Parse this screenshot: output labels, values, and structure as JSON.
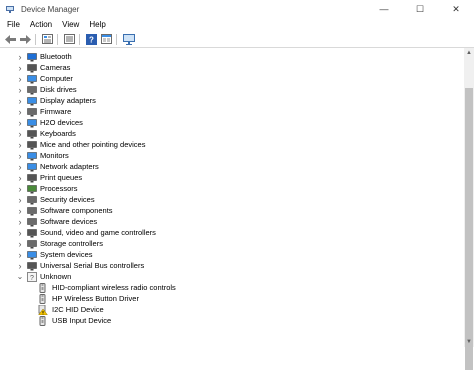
{
  "window": {
    "title": "Device Manager"
  },
  "controls": {
    "minimize": "—",
    "maximize": "☐",
    "close": "✕"
  },
  "menu": [
    "File",
    "Action",
    "View",
    "Help"
  ],
  "toolbar": [
    "back-icon",
    "forward-icon",
    "properties-icon",
    "show-hide-icon",
    "help-icon",
    "view-icon",
    "scan-hardware-icon"
  ],
  "tree": {
    "categories": [
      {
        "label": "Bluetooth",
        "icon": "bluetooth-icon",
        "color": "#1e6fd6"
      },
      {
        "label": "Cameras",
        "icon": "camera-icon",
        "color": "#555555"
      },
      {
        "label": "Computer",
        "icon": "computer-icon",
        "color": "#3a8ee6"
      },
      {
        "label": "Disk drives",
        "icon": "disk-drive-icon",
        "color": "#6b6b6b"
      },
      {
        "label": "Display adapters",
        "icon": "display-adapter-icon",
        "color": "#3a8ee6"
      },
      {
        "label": "Firmware",
        "icon": "firmware-icon",
        "color": "#6b6b6b"
      },
      {
        "label": "H2O devices",
        "icon": "h2o-device-icon",
        "color": "#3a8ee6"
      },
      {
        "label": "Keyboards",
        "icon": "keyboard-icon",
        "color": "#555555"
      },
      {
        "label": "Mice and other pointing devices",
        "icon": "mouse-icon",
        "color": "#555555"
      },
      {
        "label": "Monitors",
        "icon": "monitor-icon",
        "color": "#3a8ee6"
      },
      {
        "label": "Network adapters",
        "icon": "network-adapter-icon",
        "color": "#3a8ee6"
      },
      {
        "label": "Print queues",
        "icon": "printer-icon",
        "color": "#555555"
      },
      {
        "label": "Processors",
        "icon": "processor-icon",
        "color": "#4a8a3a"
      },
      {
        "label": "Security devices",
        "icon": "security-device-icon",
        "color": "#6b6b6b"
      },
      {
        "label": "Software components",
        "icon": "software-component-icon",
        "color": "#6b6b6b"
      },
      {
        "label": "Software devices",
        "icon": "software-device-icon",
        "color": "#6b6b6b"
      },
      {
        "label": "Sound, video and game controllers",
        "icon": "speaker-icon",
        "color": "#555555"
      },
      {
        "label": "Storage controllers",
        "icon": "storage-controller-icon",
        "color": "#6b6b6b"
      },
      {
        "label": "System devices",
        "icon": "system-device-icon",
        "color": "#3a8ee6"
      },
      {
        "label": "Universal Serial Bus controllers",
        "icon": "usb-icon",
        "color": "#555555"
      }
    ],
    "unknown": {
      "label": "Unknown",
      "icon": "unknown-device-icon",
      "children": [
        {
          "label": "HID-compliant wireless radio controls",
          "icon": "hid-device-icon",
          "warning": false
        },
        {
          "label": "HP Wireless Button Driver",
          "icon": "hid-device-icon",
          "warning": false
        },
        {
          "label": "I2C HID Device",
          "icon": "warning-icon",
          "warning": true
        },
        {
          "label": "USB Input Device",
          "icon": "hid-device-icon",
          "warning": false
        }
      ]
    }
  }
}
